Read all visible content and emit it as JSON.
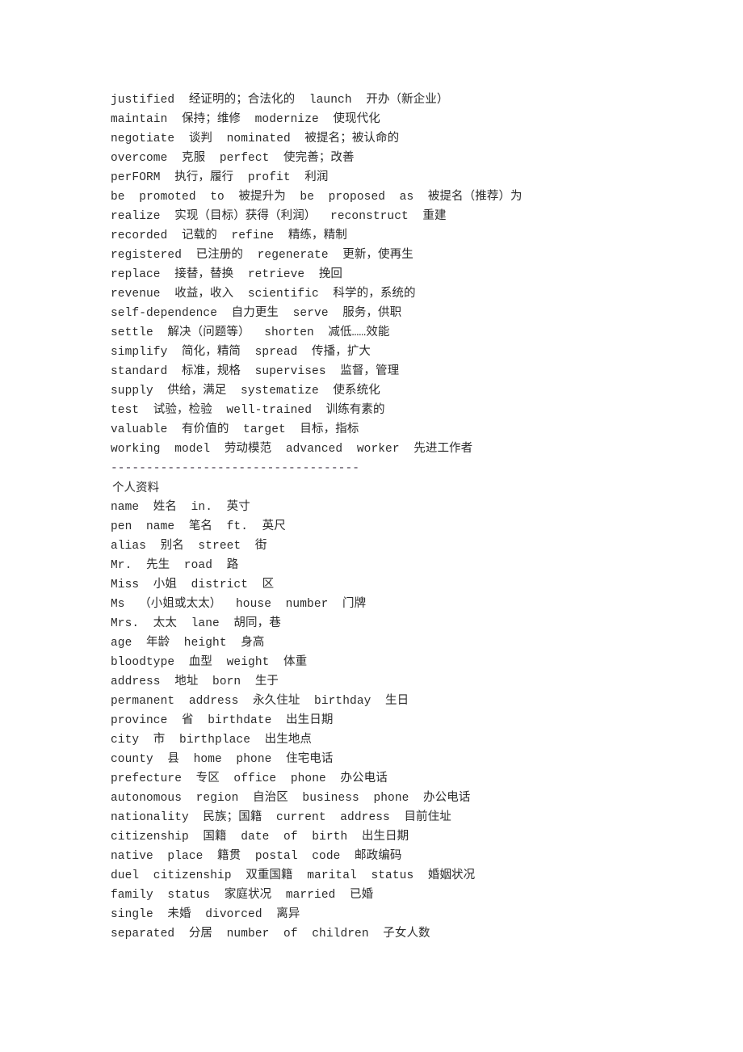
{
  "document": {
    "background_color": "#ffffff",
    "text_color": "#2b2b2b",
    "divider_color": "#4a4050",
    "sections": {
      "vocabulary": {
        "lines": [
          "justified  经证明的；合法化的  launch  开办（新企业）",
          "maintain  保持；维修  modernize  使现代化",
          "negotiate  谈判  nominated  被提名；被认命的",
          "overcome  克服  perfect  使完善；改善",
          "perFORM  执行，履行  profit  利润",
          "be  promoted  to  被提升为  be  proposed  as  被提名（推荐）为",
          "realize  实现（目标）获得（利润）  reconstruct  重建",
          "recorded  记载的  refine  精练，精制",
          "registered  已注册的  regenerate  更新，使再生",
          "replace  接替，替换  retrieve  挽回",
          "revenue  收益，收入  scientific  科学的，系统的",
          "self-dependence  自力更生  serve  服务，供职",
          "settle  解决（问题等）  shorten  减低……效能",
          "simplify  简化，精简  spread  传播，扩大",
          "standard  标准，规格  supervises  监督，管理",
          "supply  供给，满足  systematize  使系统化",
          "test  试验，检验  well-trained  训练有素的",
          "valuable  有价值的  target  目标，指标",
          "working  model  劳动模范  advanced  worker  先进工作者"
        ]
      },
      "divider": {
        "text": "-----------------------------------"
      },
      "personal_info": {
        "heading": "个人资料",
        "lines": [
          "name  姓名  in.  英寸",
          "pen  name  笔名  ft.  英尺",
          "alias  别名  street  街",
          "Mr.  先生  road  路",
          "Miss  小姐  district  区",
          "Ms  （小姐或太太）  house  number  门牌",
          "Mrs.  太太  lane  胡同，巷",
          "age  年龄  height  身高",
          "bloodtype  血型  weight  体重",
          "address  地址  born  生于",
          "permanent  address  永久住址  birthday  生日",
          "province  省  birthdate  出生日期",
          "city  市  birthplace  出生地点",
          "county  县  home  phone  住宅电话",
          "prefecture  专区  office  phone  办公电话",
          "autonomous  region  自治区  business  phone  办公电话",
          "nationality  民族；国籍  current  address  目前住址",
          "citizenship  国籍  date  of  birth  出生日期",
          "native  place  籍贯  postal  code  邮政编码",
          "duel  citizenship  双重国籍  marital  status  婚姻状况",
          "family  status  家庭状况  married  已婚",
          "single  未婚  divorced  离异",
          "separated  分居  number  of  children  子女人数"
        ]
      }
    }
  }
}
